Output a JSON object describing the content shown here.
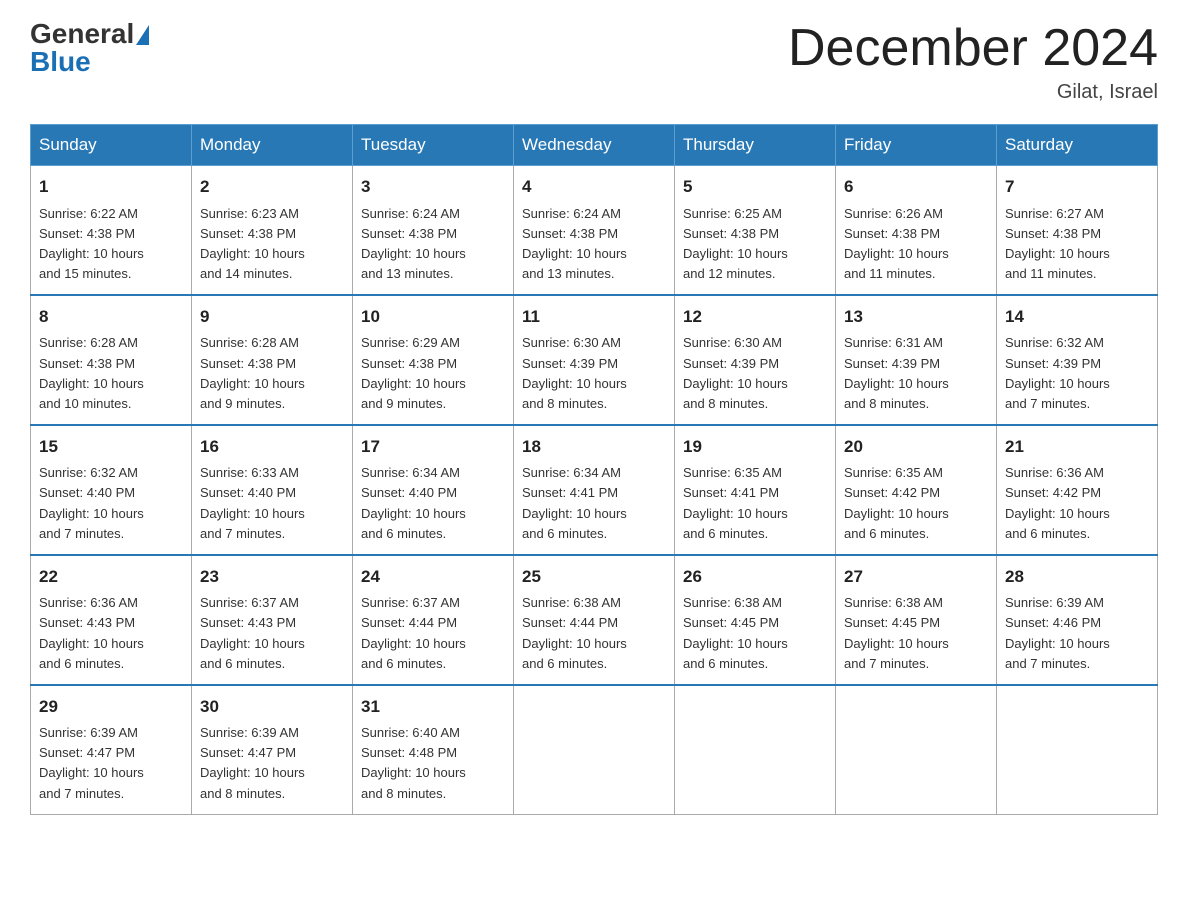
{
  "logo": {
    "general": "General",
    "blue": "Blue"
  },
  "title": "December 2024",
  "location": "Gilat, Israel",
  "days_of_week": [
    "Sunday",
    "Monday",
    "Tuesday",
    "Wednesday",
    "Thursday",
    "Friday",
    "Saturday"
  ],
  "weeks": [
    [
      {
        "day": "1",
        "sunrise": "6:22 AM",
        "sunset": "4:38 PM",
        "daylight": "10 hours and 15 minutes."
      },
      {
        "day": "2",
        "sunrise": "6:23 AM",
        "sunset": "4:38 PM",
        "daylight": "10 hours and 14 minutes."
      },
      {
        "day": "3",
        "sunrise": "6:24 AM",
        "sunset": "4:38 PM",
        "daylight": "10 hours and 13 minutes."
      },
      {
        "day": "4",
        "sunrise": "6:24 AM",
        "sunset": "4:38 PM",
        "daylight": "10 hours and 13 minutes."
      },
      {
        "day": "5",
        "sunrise": "6:25 AM",
        "sunset": "4:38 PM",
        "daylight": "10 hours and 12 minutes."
      },
      {
        "day": "6",
        "sunrise": "6:26 AM",
        "sunset": "4:38 PM",
        "daylight": "10 hours and 11 minutes."
      },
      {
        "day": "7",
        "sunrise": "6:27 AM",
        "sunset": "4:38 PM",
        "daylight": "10 hours and 11 minutes."
      }
    ],
    [
      {
        "day": "8",
        "sunrise": "6:28 AM",
        "sunset": "4:38 PM",
        "daylight": "10 hours and 10 minutes."
      },
      {
        "day": "9",
        "sunrise": "6:28 AM",
        "sunset": "4:38 PM",
        "daylight": "10 hours and 9 minutes."
      },
      {
        "day": "10",
        "sunrise": "6:29 AM",
        "sunset": "4:38 PM",
        "daylight": "10 hours and 9 minutes."
      },
      {
        "day": "11",
        "sunrise": "6:30 AM",
        "sunset": "4:39 PM",
        "daylight": "10 hours and 8 minutes."
      },
      {
        "day": "12",
        "sunrise": "6:30 AM",
        "sunset": "4:39 PM",
        "daylight": "10 hours and 8 minutes."
      },
      {
        "day": "13",
        "sunrise": "6:31 AM",
        "sunset": "4:39 PM",
        "daylight": "10 hours and 8 minutes."
      },
      {
        "day": "14",
        "sunrise": "6:32 AM",
        "sunset": "4:39 PM",
        "daylight": "10 hours and 7 minutes."
      }
    ],
    [
      {
        "day": "15",
        "sunrise": "6:32 AM",
        "sunset": "4:40 PM",
        "daylight": "10 hours and 7 minutes."
      },
      {
        "day": "16",
        "sunrise": "6:33 AM",
        "sunset": "4:40 PM",
        "daylight": "10 hours and 7 minutes."
      },
      {
        "day": "17",
        "sunrise": "6:34 AM",
        "sunset": "4:40 PM",
        "daylight": "10 hours and 6 minutes."
      },
      {
        "day": "18",
        "sunrise": "6:34 AM",
        "sunset": "4:41 PM",
        "daylight": "10 hours and 6 minutes."
      },
      {
        "day": "19",
        "sunrise": "6:35 AM",
        "sunset": "4:41 PM",
        "daylight": "10 hours and 6 minutes."
      },
      {
        "day": "20",
        "sunrise": "6:35 AM",
        "sunset": "4:42 PM",
        "daylight": "10 hours and 6 minutes."
      },
      {
        "day": "21",
        "sunrise": "6:36 AM",
        "sunset": "4:42 PM",
        "daylight": "10 hours and 6 minutes."
      }
    ],
    [
      {
        "day": "22",
        "sunrise": "6:36 AM",
        "sunset": "4:43 PM",
        "daylight": "10 hours and 6 minutes."
      },
      {
        "day": "23",
        "sunrise": "6:37 AM",
        "sunset": "4:43 PM",
        "daylight": "10 hours and 6 minutes."
      },
      {
        "day": "24",
        "sunrise": "6:37 AM",
        "sunset": "4:44 PM",
        "daylight": "10 hours and 6 minutes."
      },
      {
        "day": "25",
        "sunrise": "6:38 AM",
        "sunset": "4:44 PM",
        "daylight": "10 hours and 6 minutes."
      },
      {
        "day": "26",
        "sunrise": "6:38 AM",
        "sunset": "4:45 PM",
        "daylight": "10 hours and 6 minutes."
      },
      {
        "day": "27",
        "sunrise": "6:38 AM",
        "sunset": "4:45 PM",
        "daylight": "10 hours and 7 minutes."
      },
      {
        "day": "28",
        "sunrise": "6:39 AM",
        "sunset": "4:46 PM",
        "daylight": "10 hours and 7 minutes."
      }
    ],
    [
      {
        "day": "29",
        "sunrise": "6:39 AM",
        "sunset": "4:47 PM",
        "daylight": "10 hours and 7 minutes."
      },
      {
        "day": "30",
        "sunrise": "6:39 AM",
        "sunset": "4:47 PM",
        "daylight": "10 hours and 8 minutes."
      },
      {
        "day": "31",
        "sunrise": "6:40 AM",
        "sunset": "4:48 PM",
        "daylight": "10 hours and 8 minutes."
      },
      null,
      null,
      null,
      null
    ]
  ],
  "labels": {
    "sunrise": "Sunrise:",
    "sunset": "Sunset:",
    "daylight": "Daylight:"
  }
}
